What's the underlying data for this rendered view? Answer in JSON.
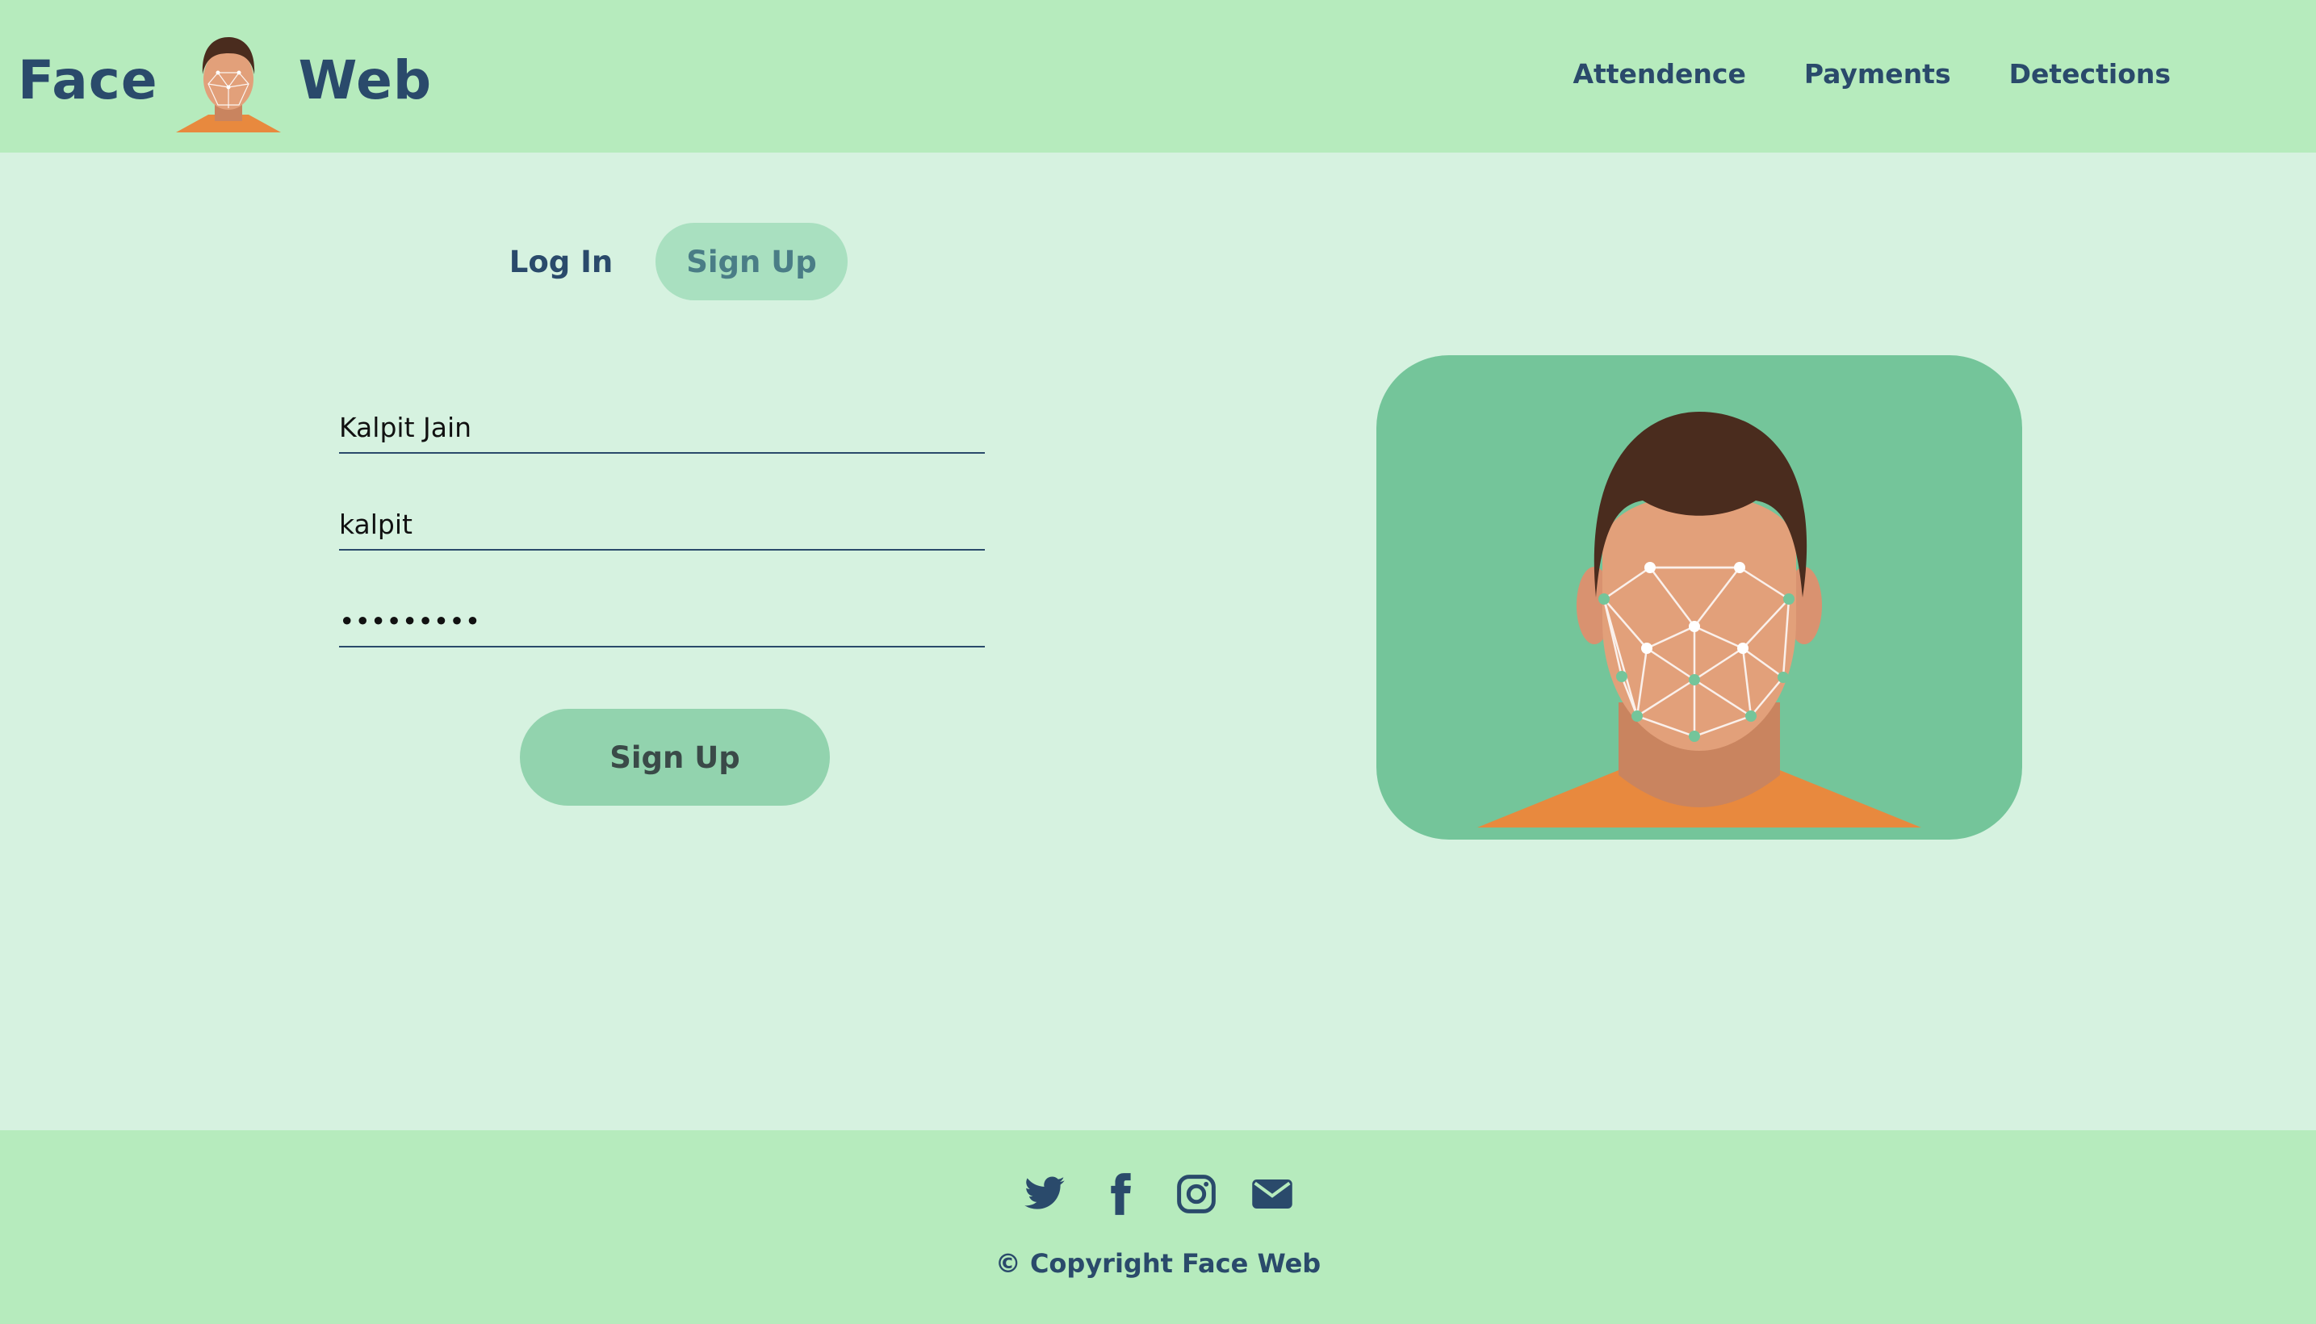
{
  "header": {
    "brand_left": "Face",
    "brand_right": "Web",
    "logo_icon": "face-scan-icon",
    "nav": [
      {
        "label": "Attendence"
      },
      {
        "label": "Payments"
      },
      {
        "label": "Detections"
      }
    ]
  },
  "tabs": {
    "login": "Log In",
    "signup": "Sign Up",
    "active": "signup"
  },
  "form": {
    "name_value": "Kalpit Jain",
    "username_value": "kalpit",
    "password_value": "kalpit123",
    "submit_label": "Sign Up"
  },
  "illustration": {
    "icon": "face-recognition-icon"
  },
  "footer": {
    "icons": [
      "twitter-icon",
      "facebook-icon",
      "instagram-icon",
      "email-icon"
    ],
    "copyright": "© Copyright Face Web"
  },
  "colors": {
    "header_bg": "#b6ebbd",
    "page_bg": "#d6f2e0",
    "text_primary": "#2a4a6b",
    "button_bg": "#92d3ae",
    "illustration_bg": "#74c59a"
  }
}
